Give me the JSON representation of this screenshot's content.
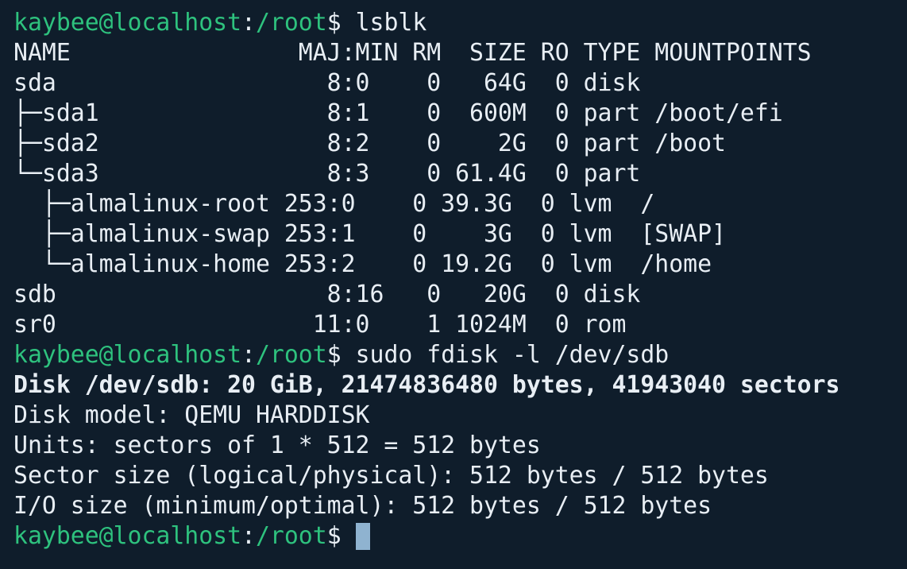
{
  "prompt": {
    "user_host": "kaybee@localhost",
    "colon": ":",
    "path": "/root",
    "dollar": "$"
  },
  "commands": {
    "lsblk": " lsblk",
    "fdisk": " sudo fdisk -l /dev/sdb"
  },
  "lsblk": {
    "header": "NAME                MAJ:MIN RM  SIZE RO TYPE MOUNTPOINTS",
    "rows": [
      "sda                   8:0    0   64G  0 disk",
      "├─sda1                8:1    0  600M  0 part /boot/efi",
      "├─sda2                8:2    0    2G  0 part /boot",
      "└─sda3                8:3    0 61.4G  0 part",
      "  ├─almalinux-root 253:0    0 39.3G  0 lvm  /",
      "  ├─almalinux-swap 253:1    0    3G  0 lvm  [SWAP]",
      "  └─almalinux-home 253:2    0 19.2G  0 lvm  /home",
      "sdb                   8:16   0   20G  0 disk",
      "sr0                  11:0    1 1024M  0 rom"
    ]
  },
  "fdisk": {
    "disk_line": "Disk /dev/sdb: 20 GiB, 21474836480 bytes, 41943040 sectors",
    "model": "Disk model: QEMU HARDDISK",
    "units": "Units: sectors of 1 * 512 = 512 bytes",
    "sector_size": "Sector size (logical/physical): 512 bytes / 512 bytes",
    "io_size": "I/O size (minimum/optimal): 512 bytes / 512 bytes"
  },
  "colors": {
    "background": "#0f1d2b",
    "prompt_green": "#2ec27e",
    "text": "#e8eef4",
    "cursor": "#8fb3d0"
  }
}
